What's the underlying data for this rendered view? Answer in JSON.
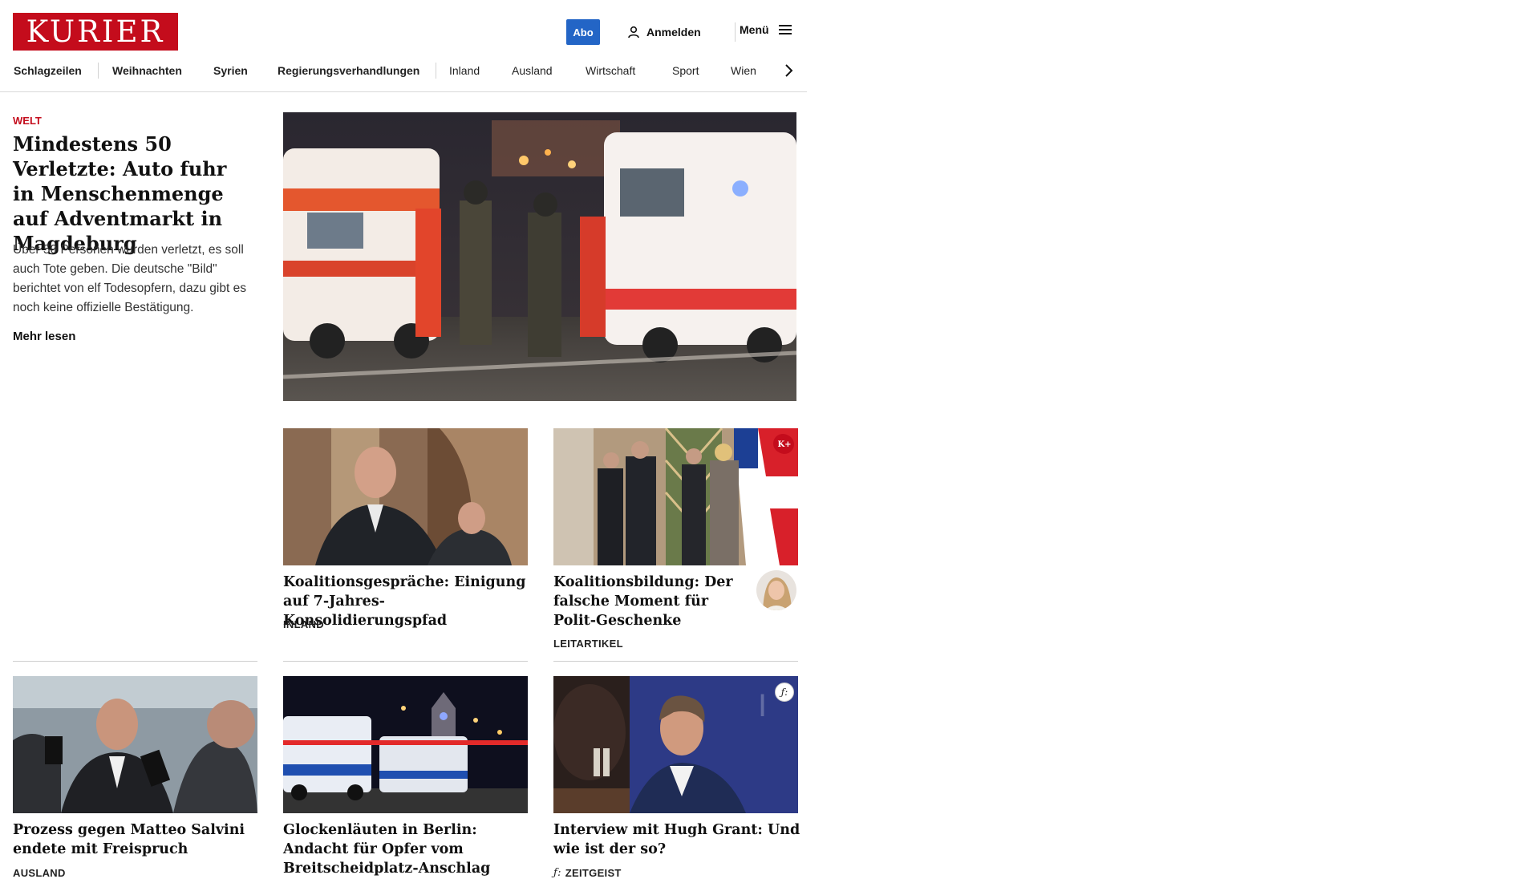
{
  "header": {
    "logo_text": "KURIER",
    "abo_label": "Abo",
    "login_label": "Anmelden",
    "menu_label": "Menü"
  },
  "nav": {
    "items": [
      "Schlagzeilen",
      "Weihnachten",
      "Syrien",
      "Regierungsverhandlungen",
      "Inland",
      "Ausland",
      "Wirtschaft",
      "Sport",
      "Wien"
    ]
  },
  "lead": {
    "kicker": "WELT",
    "title": "Mindestens 50 Verletzte: Auto fuhr in Menschen­menge auf Adventmarkt in Magdeburg",
    "teaser": "Über 50 Personen wurden verletzt, es soll auch Tote geben. Die deutsche \"Bild\" berichtet von elf Todesopfern, dazu gibt es noch keine offizielle Bestätigung.",
    "more": "Mehr lesen"
  },
  "cards": [
    {
      "title": "Koalitionsgespräche: Einigung auf 7-Jahres-Konsolidierungspfad",
      "category": "INLAND"
    },
    {
      "title": "Koalitionsbildung: Der fal­sche Moment für Polit-Geschenke",
      "category": "LEITARTIKEL",
      "badge": "K+"
    },
    {
      "title": "Prozess gegen Matteo Salvini en­dete mit Freispruch",
      "category": "AUSLAND"
    },
    {
      "title": "Glockenläuten in Berlin: Andacht für Opfer vom Breitscheidplatz-Anschlag",
      "category": ""
    },
    {
      "title": "Interview mit Hugh Grant: Und wie ist der so?",
      "category": "ZEITGEIST",
      "badge": "ƒ:"
    }
  ],
  "colors": {
    "brand_red": "#c40c1c",
    "abo_blue": "#2365c6"
  }
}
